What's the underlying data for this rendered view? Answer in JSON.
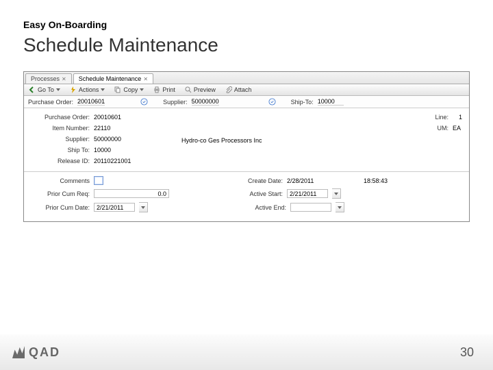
{
  "slide": {
    "eyebrow": "Easy On-Boarding",
    "title": "Schedule Maintenance",
    "pagenum": "30",
    "logo_text": "QAD"
  },
  "tabs": {
    "t1": "Processes",
    "t2": "Schedule Maintenance"
  },
  "toolbar": {
    "goto": "Go To",
    "actions": "Actions",
    "copy": "Copy",
    "print": "Print",
    "preview": "Preview",
    "attach": "Attach"
  },
  "filter": {
    "po_label": "Purchase Order:",
    "po_value": "20010601",
    "supplier_label": "Supplier:",
    "supplier_value": "50000000",
    "shipto_label": "Ship-To:",
    "shipto_value": "10000"
  },
  "details": {
    "po_label": "Purchase Order:",
    "po_value": "20010601",
    "line_label": "Line:",
    "line_value": "1",
    "item_label": "Item Number:",
    "item_value": "22110",
    "um_label": "UM:",
    "um_value": "EA",
    "supplier_label": "Supplier:",
    "supplier_value": "50000000",
    "supplier_name": "Hydro-co Ges Processors Inc",
    "shipto_label": "Ship To:",
    "shipto_value": "10000",
    "release_label": "Release ID:",
    "release_value": "20110221001"
  },
  "lower": {
    "comments_label": "Comments",
    "createdate_label": "Create Date:",
    "createdate_value": "2/28/2011",
    "createtime_value": "18:58:43",
    "priorcum_label": "Prior Cum Req:",
    "priorcum_value": "0.0",
    "activestart_label": "Active Start:",
    "activestart_value": "2/21/2011",
    "priorcumdate_label": "Prior Cum Date:",
    "priorcumdate_value": "2/21/2011",
    "activeend_label": "Active End:",
    "activeend_value": ""
  }
}
